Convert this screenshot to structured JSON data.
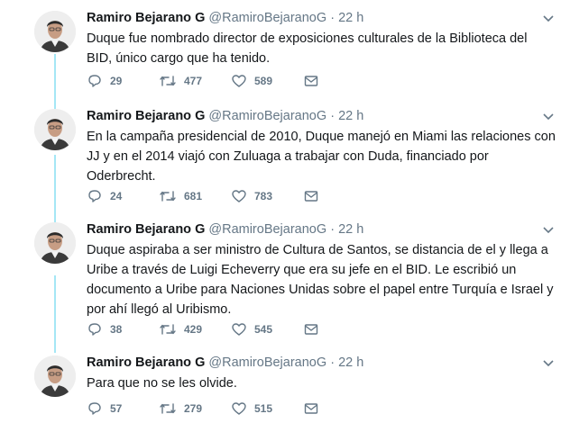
{
  "author": {
    "name": "Ramiro Bejarano G",
    "handle": "@RamiroBejaranoG",
    "separator": "·"
  },
  "colors": {
    "thread_line": "#a5e7f5",
    "secondary_text": "#657786",
    "primary_text": "#14171a"
  },
  "icons": {
    "reply": "reply-icon",
    "retweet": "retweet-icon",
    "like": "heart-icon",
    "dm": "envelope-icon",
    "caret": "chevron-down-icon"
  },
  "tweets": [
    {
      "time": "22 h",
      "text": "Duque fue nombrado director de exposiciones culturales de la Biblioteca del BID, único cargo que ha tenido.",
      "replies": "29",
      "retweets": "477",
      "likes": "589"
    },
    {
      "time": "22 h",
      "text": "En la campaña presidencial de 2010, Duque manejó en Miami las relaciones con JJ y en el 2014 viajó con Zuluaga a trabajar con Duda, financiado por Oderbrecht.",
      "replies": "24",
      "retweets": "681",
      "likes": "783"
    },
    {
      "time": "22 h",
      "text": "Duque aspiraba a ser ministro de Cultura de Santos, se distancia de el y llega a Uribe a través de Luigi Echeverry que era su jefe en el BID. Le escribió un documento a Uribe para Naciones Unidas sobre el papel entre Turquía e Israel y por ahí llegó al Uribismo.",
      "replies": "38",
      "retweets": "429",
      "likes": "545"
    },
    {
      "time": "22 h",
      "text": "Para que no se les olvide.",
      "replies": "57",
      "retweets": "279",
      "likes": "515"
    }
  ]
}
